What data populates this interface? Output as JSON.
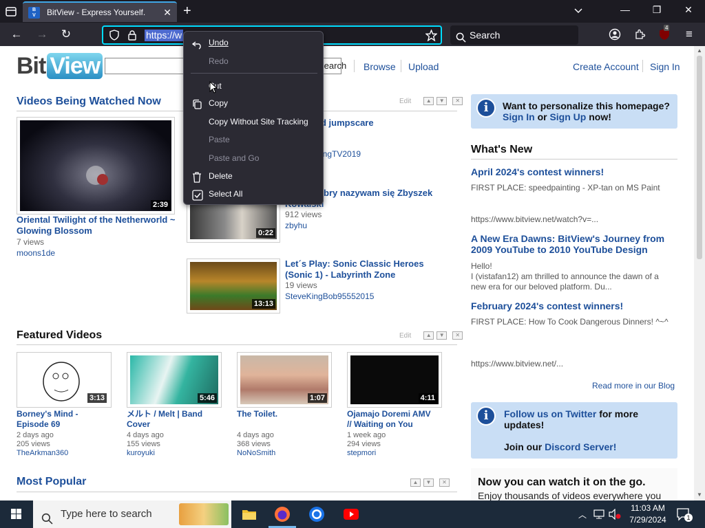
{
  "browser": {
    "tab_title": "BitView - Express Yourself.",
    "favicon_text": "Bit\nView",
    "url_visible": "https://w",
    "search_placeholder": "Search",
    "badge_count": "4"
  },
  "site": {
    "logo_bit": "Bit",
    "logo_view": "View",
    "search_button": "Search",
    "nav_links": [
      "Browse",
      "Upload"
    ],
    "account_links": [
      "Create Account",
      "Sign In"
    ],
    "edit_label": "Edit"
  },
  "watched_now": {
    "heading": "Videos Being Watched Now",
    "videos": [
      {
        "title": "Oriental Twilight of the Netherworld ~ Glowing Blossom",
        "views": "7 views",
        "user": "moons1de",
        "duration": "2:39"
      },
      {
        "title": "...d jumpscare",
        "views": "",
        "user": "...ingTV2019",
        "duration": ""
      },
      {
        "title": "...bry nazywam się Zbyszek ...dwalski",
        "views": "912 views",
        "user": "zbyhu",
        "duration": "0:22"
      },
      {
        "title": "Let´s Play: Sonic Classic Heroes (Sonic 1) - Labyrinth Zone",
        "views": "19 views",
        "user": "SteveKingBob95552015",
        "duration": "13:13"
      }
    ]
  },
  "featured": {
    "heading": "Featured Videos",
    "videos": [
      {
        "title": "Borney's Mind - Episode 69",
        "age": "2 days ago",
        "views": "205 views",
        "user": "TheArkman360",
        "duration": "3:13"
      },
      {
        "title": "メルト / Melt | Band Cover",
        "age": "4 days ago",
        "views": "155 views",
        "user": "kuroyuki",
        "duration": "5:46"
      },
      {
        "title": "The Toilet.",
        "age": "4 days ago",
        "views": "368 views",
        "user": "NoNoSmith",
        "duration": "1:07"
      },
      {
        "title": "Ojamajo Doremi AMV // Waiting on You",
        "age": "1 week ago",
        "views": "294 views",
        "user": "stepmori",
        "duration": "4:11"
      }
    ]
  },
  "most_popular": {
    "heading": "Most Popular"
  },
  "sidebar": {
    "personalize": {
      "text": "Want to personalize this homepage?",
      "sign_in": "Sign In",
      "or": "or",
      "sign_up": "Sign Up",
      "now": "now!"
    },
    "whats_new": "What's New",
    "news": [
      {
        "title": "April 2024's contest winners!",
        "text": "FIRST PLACE: speedpainting - XP-tan on MS Paint",
        "link": "https://www.bitview.net/watch?v=..."
      },
      {
        "title": "A New Era Dawns: BitView's Journey from 2009 YouTube to 2010 YouTube Design",
        "text1": "Hello!",
        "text2": "I (vistafan12) am thrilled to announce the dawn of a new era for our beloved platform. Du..."
      },
      {
        "title": "February 2024's contest winners!",
        "text": "FIRST PLACE: How To Cook Dangerous Dinners! ^~^",
        "link": "https://www.bitview.net/..."
      }
    ],
    "read_more": "Read more in our Blog",
    "twitter": {
      "link": "Follow us on Twitter",
      "rest": "for more updates!",
      "join": "Join our",
      "discord": "Discord Server!"
    },
    "mobile": {
      "heading": "Now you can watch it on the go.",
      "sub": "Enjoy thousands of videos everywhere you"
    }
  },
  "context_menu": {
    "items": [
      {
        "label": "Undo",
        "enabled": true,
        "icon": "undo-icon"
      },
      {
        "label": "Redo",
        "enabled": false,
        "icon": ""
      },
      {
        "label": "Cut",
        "enabled": true,
        "icon": ""
      },
      {
        "label": "Copy",
        "enabled": true,
        "icon": "copy-icon"
      },
      {
        "label": "Copy Without Site Tracking",
        "enabled": true,
        "icon": ""
      },
      {
        "label": "Paste",
        "enabled": false,
        "icon": ""
      },
      {
        "label": "Paste and Go",
        "enabled": false,
        "icon": ""
      },
      {
        "label": "Delete",
        "enabled": true,
        "icon": "trash-icon"
      },
      {
        "label": "Select All",
        "enabled": true,
        "icon": "select-all-icon"
      }
    ]
  },
  "taskbar": {
    "search_placeholder": "Type here to search",
    "time": "11:03 AM",
    "date": "7/29/2024",
    "notification_count": "1"
  }
}
